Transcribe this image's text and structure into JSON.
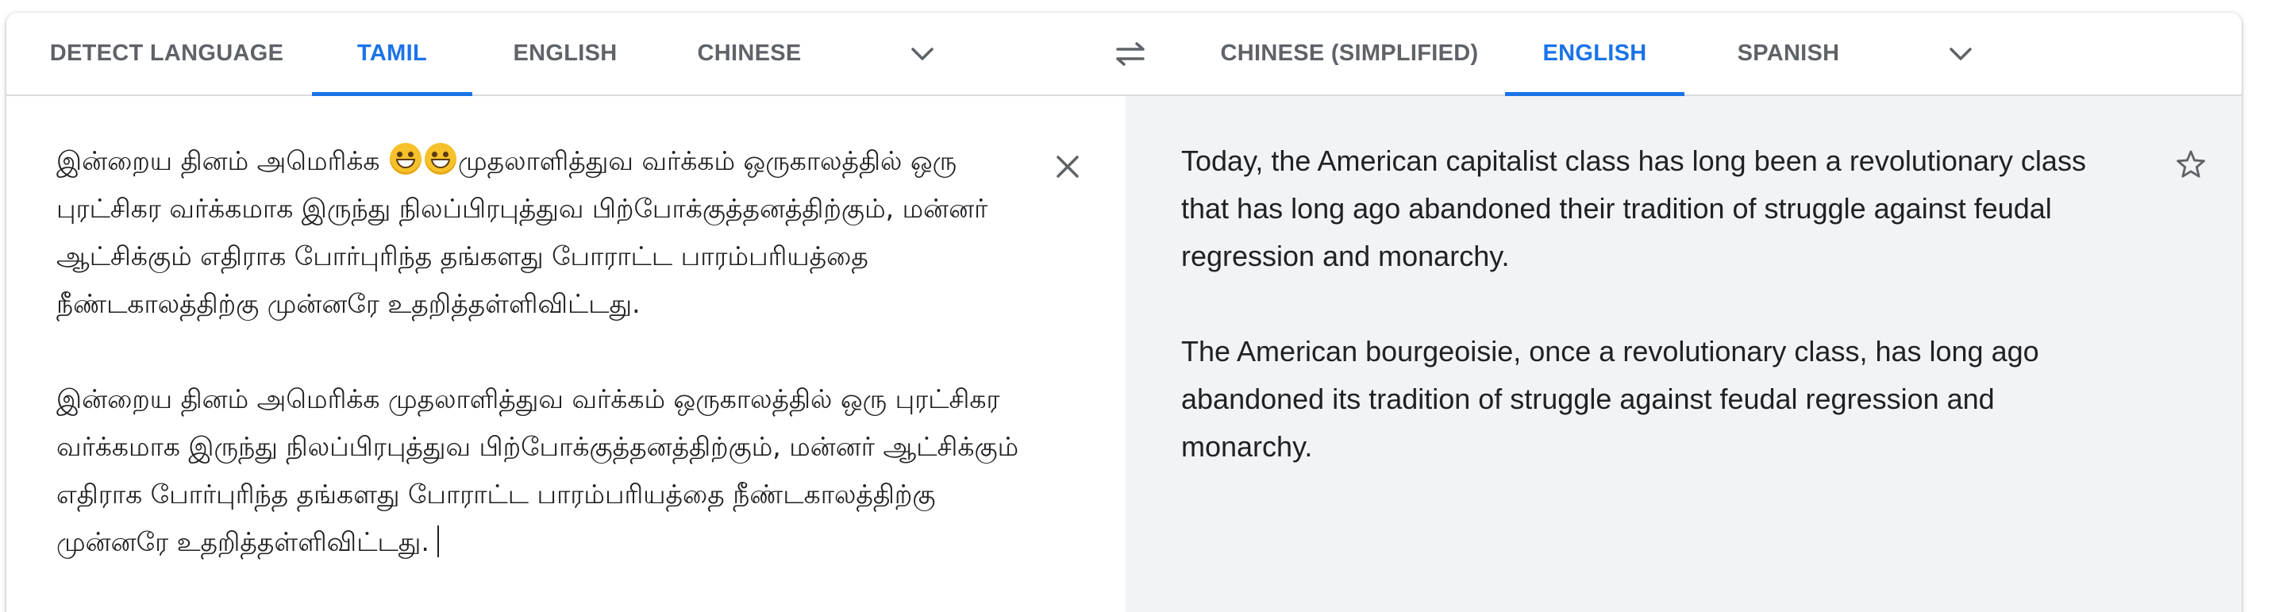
{
  "source_tabs": [
    {
      "label": "DETECT LANGUAGE",
      "active": false
    },
    {
      "label": "TAMIL",
      "active": true
    },
    {
      "label": "ENGLISH",
      "active": false
    },
    {
      "label": "CHINESE",
      "active": false
    }
  ],
  "target_tabs": [
    {
      "label": "CHINESE (SIMPLIFIED)",
      "active": false
    },
    {
      "label": "ENGLISH",
      "active": true
    },
    {
      "label": "SPANISH",
      "active": false
    }
  ],
  "icons": {
    "source_more": "chevron-down-icon",
    "swap": "swap-languages-icon",
    "target_more": "chevron-down-icon",
    "clear": "close-icon",
    "save": "star-icon"
  },
  "source": {
    "paragraph1_before_emoji": "இன்றைய தினம் அமெரிக்க ",
    "emoji_name": "grinning-face-with-smiling-eyes",
    "emoji_count": 2,
    "paragraph1_after_emoji": "முதலாளித்துவ வர்க்கம் ஒருகாலத்தில் ஒரு புரட்சிகர வர்க்கமாக இருந்து நிலப்பிரபுத்துவ பிற்போக்குத்தனத்திற்கும், மன்னர் ஆட்சிக்கும் எதிராக போர்புரிந்த தங்களது போராட்ட பாரம்பரியத்தை நீண்டகாலத்திற்கு முன்னரே உதறித்தள்ளிவிட்டது.",
    "paragraph2": "இன்றைய தினம் அமெரிக்க முதலாளித்துவ வர்க்கம் ஒருகாலத்தில் ஒரு புரட்சிகர வர்க்கமாக இருந்து நிலப்பிரபுத்துவ பிற்போக்குத்தனத்திற்கும், மன்னர் ஆட்சிக்கும் எதிராக போர்புரிந்த தங்களது போராட்ட பாரம்பரியத்தை நீண்டகாலத்திற்கு முன்னரே உதறித்தள்ளிவிட்டது."
  },
  "translation": {
    "paragraph1": "Today, the American capitalist class has long been a revolutionary class that has long ago abandoned their tradition of struggle against feudal regression and monarchy.",
    "paragraph2": "The American bourgeoisie, once a revolutionary class, has long ago abandoned its tradition of struggle against feudal regression and monarchy."
  },
  "colors": {
    "accent": "#1a73e8",
    "tab_text": "#5f6368",
    "body_text": "#202124",
    "translation_bg": "#f1f3f4",
    "divider": "#dadce0"
  }
}
